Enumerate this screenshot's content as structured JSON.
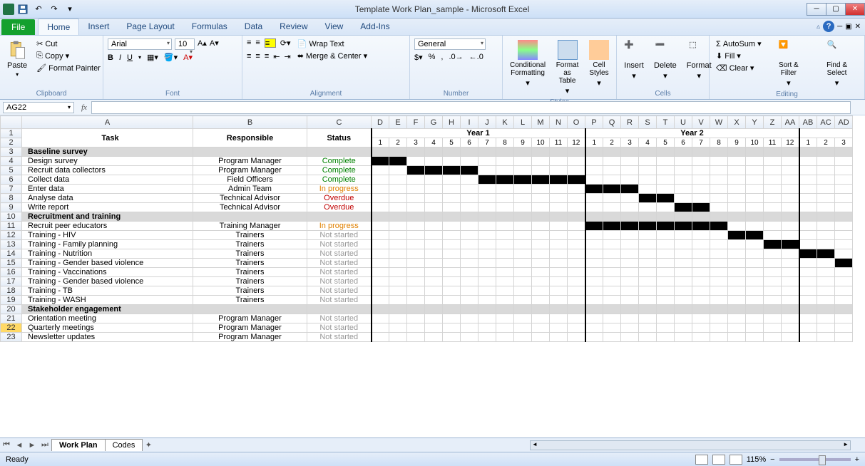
{
  "title": "Template Work Plan_sample  -  Microsoft Excel",
  "tabs": [
    "Home",
    "Insert",
    "Page Layout",
    "Formulas",
    "Data",
    "Review",
    "View",
    "Add-Ins"
  ],
  "file_label": "File",
  "clipboard": {
    "cut": "Cut",
    "copy": "Copy",
    "fp": "Format Painter",
    "label": "Clipboard"
  },
  "font": {
    "name": "Arial",
    "size": "10",
    "label": "Font"
  },
  "alignment": {
    "wrap": "Wrap Text",
    "merge": "Merge & Center",
    "label": "Alignment"
  },
  "number": {
    "fmt": "General",
    "label": "Number"
  },
  "styles": {
    "cf": "Conditional Formatting",
    "fat": "Format as Table",
    "cs": "Cell Styles",
    "label": "Styles"
  },
  "cells": {
    "ins": "Insert",
    "del": "Delete",
    "fmt": "Format",
    "label": "Cells"
  },
  "editing": {
    "as": "AutoSum",
    "fill": "Fill",
    "clr": "Clear",
    "sort": "Sort & Filter",
    "find": "Find & Select",
    "label": "Editing"
  },
  "namebox": "AG22",
  "cols": {
    "A": "A",
    "B": "B",
    "C": "C"
  },
  "timecols": [
    "D",
    "E",
    "F",
    "G",
    "H",
    "I",
    "J",
    "K",
    "L",
    "M",
    "N",
    "O",
    "P",
    "Q",
    "R",
    "S",
    "T",
    "U",
    "V",
    "W",
    "X",
    "Y",
    "Z",
    "AA",
    "AB",
    "AC",
    "AD"
  ],
  "headers": {
    "task": "Task",
    "resp": "Responsible",
    "status": "Status",
    "y1": "Year 1",
    "y2": "Year 2"
  },
  "months_y1": [
    "1",
    "2",
    "3",
    "4",
    "5",
    "6",
    "7",
    "8",
    "9",
    "10",
    "11",
    "12"
  ],
  "months_y2": [
    "1",
    "2",
    "3",
    "4",
    "5",
    "6",
    "7",
    "8",
    "9",
    "10",
    "11",
    "12"
  ],
  "months_y3": [
    "1",
    "2",
    "3"
  ],
  "rows": [
    {
      "n": 3,
      "type": "section",
      "task": "Baseline survey"
    },
    {
      "n": 4,
      "task": "Design survey",
      "resp": "Program Manager",
      "status": "Complete",
      "scls": "st-complete",
      "bars": [
        0,
        1
      ]
    },
    {
      "n": 5,
      "task": "Recruit data collectors",
      "resp": "Program Manager",
      "status": "Complete",
      "scls": "st-complete",
      "bars": [
        2,
        3,
        4,
        5
      ]
    },
    {
      "n": 6,
      "task": "Collect data",
      "resp": "Field Officers",
      "status": "Complete",
      "scls": "st-complete",
      "bars": [
        6,
        7,
        8,
        9,
        10,
        11
      ]
    },
    {
      "n": 7,
      "task": "Enter data",
      "resp": "Admin Team",
      "status": "In progress",
      "scls": "st-progress",
      "bars": [
        12,
        13,
        14
      ]
    },
    {
      "n": 8,
      "task": "Analyse data",
      "resp": "Technical Advisor",
      "status": "Overdue",
      "scls": "st-overdue",
      "bars": [
        15,
        16
      ]
    },
    {
      "n": 9,
      "task": "Write report",
      "resp": "Technical Advisor",
      "status": "Overdue",
      "scls": "st-overdue",
      "bars": [
        17,
        18
      ]
    },
    {
      "n": 10,
      "type": "section",
      "task": "Recruitment and training"
    },
    {
      "n": 11,
      "task": "Recruit peer educators",
      "resp": "Training Manager",
      "status": "In progress",
      "scls": "st-progress",
      "bars": [
        12,
        13,
        14,
        15,
        16,
        17,
        18,
        19
      ]
    },
    {
      "n": 12,
      "task": "Training - HIV",
      "resp": "Trainers",
      "status": "Not started",
      "scls": "st-notstarted",
      "bars": [
        20,
        21
      ]
    },
    {
      "n": 13,
      "task": "Training - Family planning",
      "resp": "Trainers",
      "status": "Not started",
      "scls": "st-notstarted",
      "bars": [
        22,
        23
      ]
    },
    {
      "n": 14,
      "task": "Training - Nutrition",
      "resp": "Trainers",
      "status": "Not started",
      "scls": "st-notstarted",
      "bars": [
        24,
        25
      ]
    },
    {
      "n": 15,
      "task": "Training - Gender based violence",
      "resp": "Trainers",
      "status": "Not started",
      "scls": "st-notstarted",
      "bars": [
        26
      ]
    },
    {
      "n": 16,
      "task": "Training - Vaccinations",
      "resp": "Trainers",
      "status": "Not started",
      "scls": "st-notstarted",
      "bars": []
    },
    {
      "n": 17,
      "task": "Training - Gender based violence",
      "resp": "Trainers",
      "status": "Not started",
      "scls": "st-notstarted",
      "bars": []
    },
    {
      "n": 18,
      "task": "Training - TB",
      "resp": "Trainers",
      "status": "Not started",
      "scls": "st-notstarted",
      "bars": []
    },
    {
      "n": 19,
      "task": "Training - WASH",
      "resp": "Trainers",
      "status": "Not started",
      "scls": "st-notstarted",
      "bars": []
    },
    {
      "n": 20,
      "type": "section",
      "task": "Stakeholder engagement"
    },
    {
      "n": 21,
      "task": "Orientation meeting",
      "resp": "Program Manager",
      "status": "Not started",
      "scls": "st-notstarted",
      "bars": []
    },
    {
      "n": 22,
      "task": "Quarterly meetings",
      "resp": "Program Manager",
      "status": "Not started",
      "scls": "st-notstarted",
      "bars": [],
      "sel": true
    },
    {
      "n": 23,
      "task": "Newsletter updates",
      "resp": "Program Manager",
      "status": "Not started",
      "scls": "st-notstarted",
      "bars": []
    }
  ],
  "sheets": [
    "Work Plan",
    "Codes"
  ],
  "status": "Ready",
  "zoom": "115%"
}
